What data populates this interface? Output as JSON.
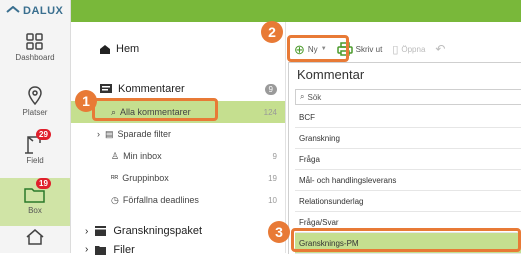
{
  "app": {
    "logo": "DALUX"
  },
  "rail": {
    "items": [
      {
        "label": "Dashboard"
      },
      {
        "label": "Platser"
      },
      {
        "label": "Field",
        "badge": "29"
      },
      {
        "label": "Box",
        "badge": "19"
      }
    ]
  },
  "nav": {
    "home": "Hem",
    "comments": {
      "label": "Kommentarer",
      "count": "9"
    },
    "items": [
      {
        "label": "Alla kommentarer",
        "count": "124"
      },
      {
        "label": "Sparade filter",
        "count": ""
      },
      {
        "label": "Min inbox",
        "count": "9"
      },
      {
        "label": "Gruppinbox",
        "count": "19"
      },
      {
        "label": "Förfallna deadlines",
        "count": "10"
      }
    ],
    "review_package": "Granskningspaket",
    "files_partial": "Filer"
  },
  "toolbar": {
    "new": "Ny",
    "print": "Skriv ut",
    "open": "Öppna"
  },
  "panel": {
    "title": "Kommentar",
    "search_placeholder": "Sök",
    "options": [
      "BCF",
      "Granskning",
      "Fråga",
      "Mål- och handlingsleverans",
      "Relationsunderlag",
      "Fråga/Svar",
      "Gransknings-PM"
    ]
  },
  "callouts": [
    "1",
    "2",
    "3"
  ],
  "colors": {
    "accent_green": "#79b83a",
    "selection": "#c5df8f",
    "callout": "#e87a36",
    "badge": "#e0202c"
  }
}
